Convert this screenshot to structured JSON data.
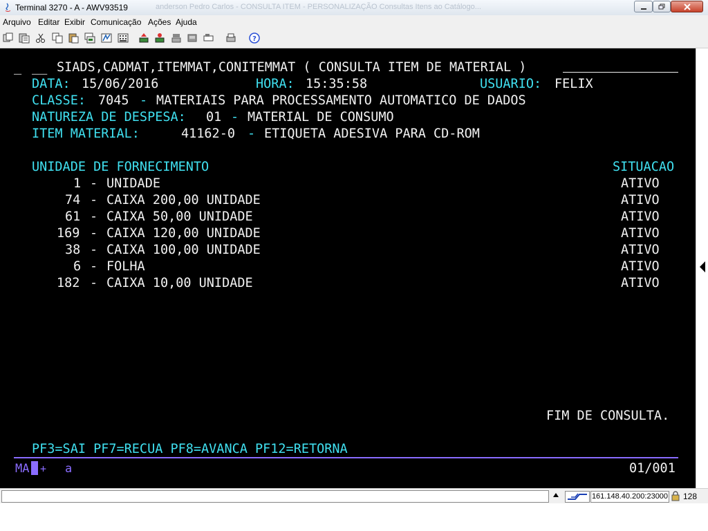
{
  "window": {
    "title": "Terminal 3270 - A - AWV93519",
    "ghost_title": "anderson Pedro Carlos  -  CONSULTA ITEM  -  PERSONALIZAÇÃO Consultas Itens ao Catálogo..."
  },
  "menu": [
    "Arquivo",
    "Editar",
    "Exibir",
    "Comunicação",
    "Ações",
    "Ajuda"
  ],
  "toolbar_icons": [
    "copy-screen-icon",
    "paste-icon",
    "cut-icon",
    "copy-icon",
    "paste-special-icon",
    "print-icon",
    "macro-icon",
    "keypad-icon",
    "send-icon",
    "receive-icon",
    "record-icon",
    "play-icon",
    "stop-icon",
    "print-screen-icon",
    "help-icon"
  ],
  "screen": {
    "header": "SIADS,CADMAT,ITEMMAT,CONITEMMAT ( CONSULTA ITEM DE MATERIAL )",
    "data_label": "DATA:",
    "data_value": "15/06/2016",
    "hora_label": "HORA:",
    "hora_value": "15:35:58",
    "usuario_label": "USUARIO:",
    "usuario_value": "FELIX",
    "classe_label": "CLASSE:",
    "classe_code": "7045",
    "classe_desc": "MATERIAIS PARA PROCESSAMENTO AUTOMATICO DE DADOS",
    "natureza_label": "NATUREZA DE DESPESA:",
    "natureza_code": "01",
    "natureza_desc": "MATERIAL DE CONSUMO",
    "item_label": "ITEM MATERIAL:",
    "item_code": "41162-0",
    "item_desc": "ETIQUETA ADESIVA PARA CD-ROM",
    "col_unidade": "UNIDADE DE FORNECIMENTO",
    "col_situacao": "SITUACAO",
    "rows": [
      {
        "code": "1",
        "desc": "UNIDADE",
        "status": "ATIVO"
      },
      {
        "code": "74",
        "desc": "CAIXA 200,00 UNIDADE",
        "status": "ATIVO"
      },
      {
        "code": "61",
        "desc": "CAIXA 50,00 UNIDADE",
        "status": "ATIVO"
      },
      {
        "code": "169",
        "desc": "CAIXA 120,00 UNIDADE",
        "status": "ATIVO"
      },
      {
        "code": "38",
        "desc": "CAIXA 100,00 UNIDADE",
        "status": "ATIVO"
      },
      {
        "code": "6",
        "desc": "FOLHA",
        "status": "ATIVO"
      },
      {
        "code": "182",
        "desc": "CAIXA 10,00 UNIDADE",
        "status": "ATIVO"
      }
    ],
    "fim": "FIM DE CONSULTA.",
    "pfkeys": "PF3=SAI PF7=RECUA PF8=AVANCA PF12=RETORNA",
    "oia_ma": "MA",
    "oia_plus": "+",
    "oia_a": "a",
    "page": "01/001"
  },
  "status": {
    "ip": "161.148.40.200:23000",
    "num": "128"
  },
  "colors": {
    "cyan": "#40e0f0",
    "white": "#f2f2f2",
    "separator": "#8a6cff"
  }
}
